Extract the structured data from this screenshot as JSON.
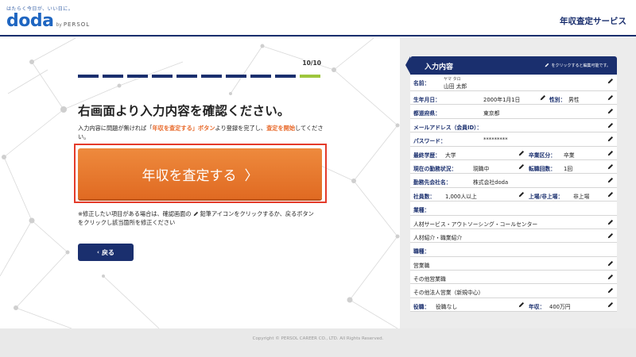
{
  "header": {
    "tagline": "はたらく今日が、いい日に。",
    "logo": "doda",
    "logo_by": "by",
    "logo_persol": "PERSOL",
    "title": "年収査定サービス"
  },
  "progress": {
    "step_label": "10/10",
    "total": 10,
    "current": 10
  },
  "main": {
    "headline": "右画面より入力内容を確認ください。",
    "desc_1": "入力内容に問題が無ければ「",
    "desc_em1": "年収を査定する」ボタン",
    "desc_2": "より登録を完了し、",
    "desc_em2": "査定を開始",
    "desc_3": "してください。",
    "cta_label": "年収を査定する",
    "cta_chevron": "〉",
    "note_1": "※修正したい項目がある場合は、確認画面の",
    "note_2": "鉛筆アイコンをクリックするか、戻るボタンをクリックし該当箇所を修正ください",
    "back_chevron": "‹",
    "back_label": "戻る"
  },
  "panel": {
    "title": "入力内容",
    "hint": "をクリックすると編集可能です。",
    "name_label": "名前：",
    "name_kana": "ヤマ タロ",
    "name_value": "山田 太郎",
    "birth_label": "生年月日：",
    "birth_value": "2000年1月1日",
    "gender_label": "性別：",
    "gender_value": "男性",
    "pref_label": "都道府県：",
    "pref_value": "東京都",
    "email_label": "メールアドレス（会員ID）：",
    "password_label": "パスワード：",
    "password_value": "*********",
    "edu_label": "最終学歴：",
    "edu_value": "大学",
    "grad_label": "卒業区分：",
    "grad_value": "卒業",
    "status_label": "現在の勤務状況：",
    "status_value": "現職中",
    "jobchange_label": "転職回数：",
    "jobchange_value": "1回",
    "company_label": "勤務先会社名：",
    "company_value": "株式会社doda",
    "employees_label": "社員数：",
    "employees_value": "1,000人以上",
    "listed_label": "上場/非上場：",
    "listed_value": "非上場",
    "industry_label": "業種：",
    "industry_1": "人材サービス・アウトソーシング・コールセンター",
    "industry_2": "人材紹介・職業紹介",
    "occupation_label": "職種：",
    "occupation_1": "営業職",
    "occupation_2": "その他営業職",
    "occupation_3": "その他法人営業（新規中心）",
    "position_label": "役職：",
    "position_value": "役職なし",
    "income_label": "年収：",
    "income_value": "400万円"
  },
  "footer": {
    "copyright": "Copyright © PERSOL CAREER CO., LTD. All Rights Reserved."
  },
  "colors": {
    "navy": "#1a2f6e",
    "orange": "#e8692a",
    "green": "#9ec63c",
    "red_frame": "#e43b2a"
  }
}
